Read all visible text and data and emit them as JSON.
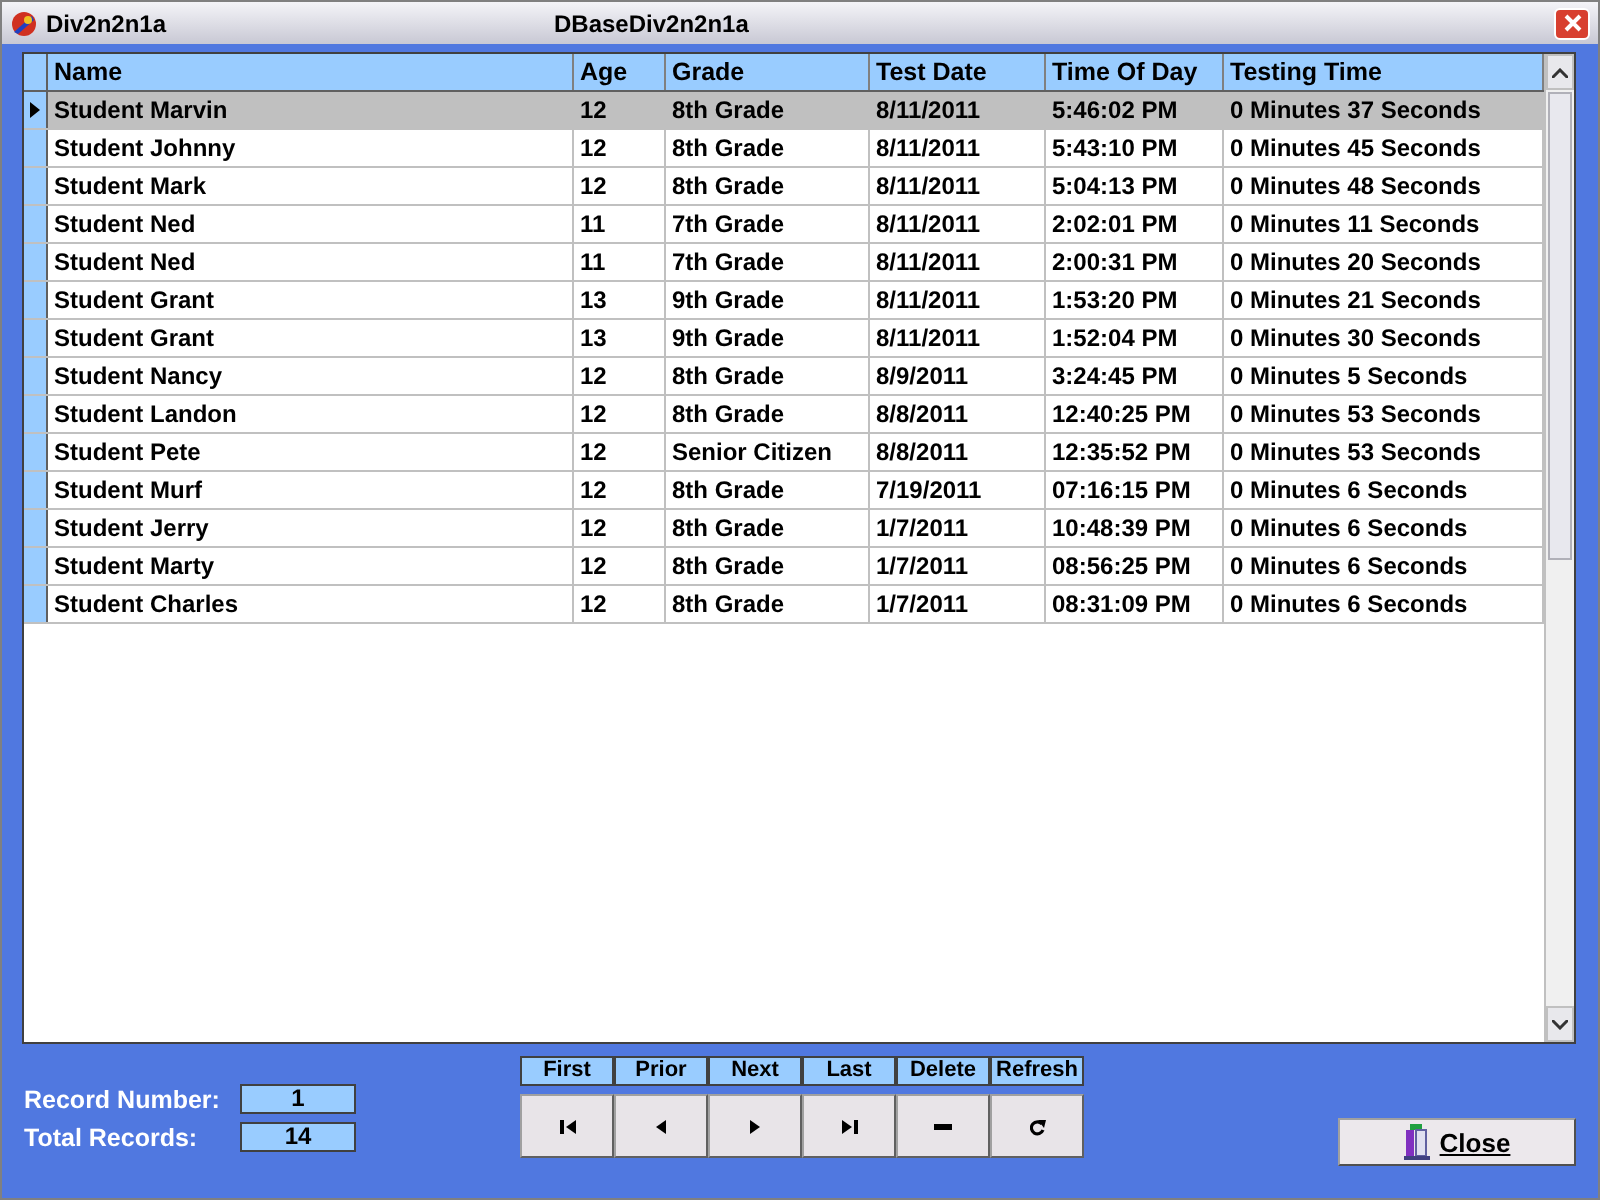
{
  "window": {
    "title": "Div2n2n1a",
    "caption": "DBaseDiv2n2n1a"
  },
  "table": {
    "columns": [
      "Name",
      "Age",
      "Grade",
      "Test Date",
      "Time Of Day",
      "Testing Time"
    ],
    "rows": [
      {
        "selected": true,
        "cells": [
          "Student Marvin",
          "12",
          "8th Grade",
          "8/11/2011",
          "5:46:02 PM",
          "0 Minutes  37 Seconds"
        ]
      },
      {
        "selected": false,
        "cells": [
          "Student Johnny",
          "12",
          "8th Grade",
          "8/11/2011",
          "5:43:10 PM",
          "0 Minutes  45 Seconds"
        ]
      },
      {
        "selected": false,
        "cells": [
          "Student Mark",
          "12",
          "8th Grade",
          "8/11/2011",
          "5:04:13 PM",
          "0 Minutes  48 Seconds"
        ]
      },
      {
        "selected": false,
        "cells": [
          "Student Ned",
          "11",
          "7th Grade",
          "8/11/2011",
          "2:02:01 PM",
          "0 Minutes  11 Seconds"
        ]
      },
      {
        "selected": false,
        "cells": [
          "Student Ned",
          "11",
          "7th Grade",
          "8/11/2011",
          "2:00:31 PM",
          "0 Minutes  20 Seconds"
        ]
      },
      {
        "selected": false,
        "cells": [
          "Student Grant",
          "13",
          "9th Grade",
          "8/11/2011",
          "1:53:20 PM",
          "0 Minutes  21 Seconds"
        ]
      },
      {
        "selected": false,
        "cells": [
          "Student Grant",
          "13",
          "9th Grade",
          "8/11/2011",
          "1:52:04 PM",
          "0 Minutes  30 Seconds"
        ]
      },
      {
        "selected": false,
        "cells": [
          "Student Nancy",
          "12",
          "8th Grade",
          "8/9/2011",
          "3:24:45 PM",
          "0 Minutes  5 Seconds"
        ]
      },
      {
        "selected": false,
        "cells": [
          "Student Landon",
          "12",
          "8th Grade",
          "8/8/2011",
          "12:40:25 PM",
          "0 Minutes  53 Seconds"
        ]
      },
      {
        "selected": false,
        "cells": [
          "Student Pete",
          "12",
          "Senior Citizen",
          "8/8/2011",
          "12:35:52 PM",
          "0 Minutes  53 Seconds"
        ]
      },
      {
        "selected": false,
        "cells": [
          "Student Murf",
          "12",
          "8th Grade",
          "7/19/2011",
          "07:16:15 PM",
          "0 Minutes  6 Seconds"
        ]
      },
      {
        "selected": false,
        "cells": [
          "Student Jerry",
          "12",
          "8th Grade",
          "1/7/2011",
          "10:48:39 PM",
          "0 Minutes  6 Seconds"
        ]
      },
      {
        "selected": false,
        "cells": [
          "Student Marty",
          "12",
          "8th Grade",
          "1/7/2011",
          "08:56:25 PM",
          "0 Minutes  6 Seconds"
        ]
      },
      {
        "selected": false,
        "cells": [
          "Student Charles",
          "12",
          "8th Grade",
          "1/7/2011",
          "08:31:09 PM",
          "0 Minutes  6 Seconds"
        ]
      }
    ]
  },
  "record_number": {
    "label": "Record Number:",
    "value": "1"
  },
  "total_records": {
    "label": "Total Records:",
    "value": "14"
  },
  "navigator": [
    {
      "label": "First",
      "kind": "first"
    },
    {
      "label": "Prior",
      "kind": "prior"
    },
    {
      "label": "Next",
      "kind": "next"
    },
    {
      "label": "Last",
      "kind": "last"
    },
    {
      "label": "Delete",
      "kind": "delete"
    },
    {
      "label": "Refresh",
      "kind": "refresh"
    }
  ],
  "close_button": "Close"
}
